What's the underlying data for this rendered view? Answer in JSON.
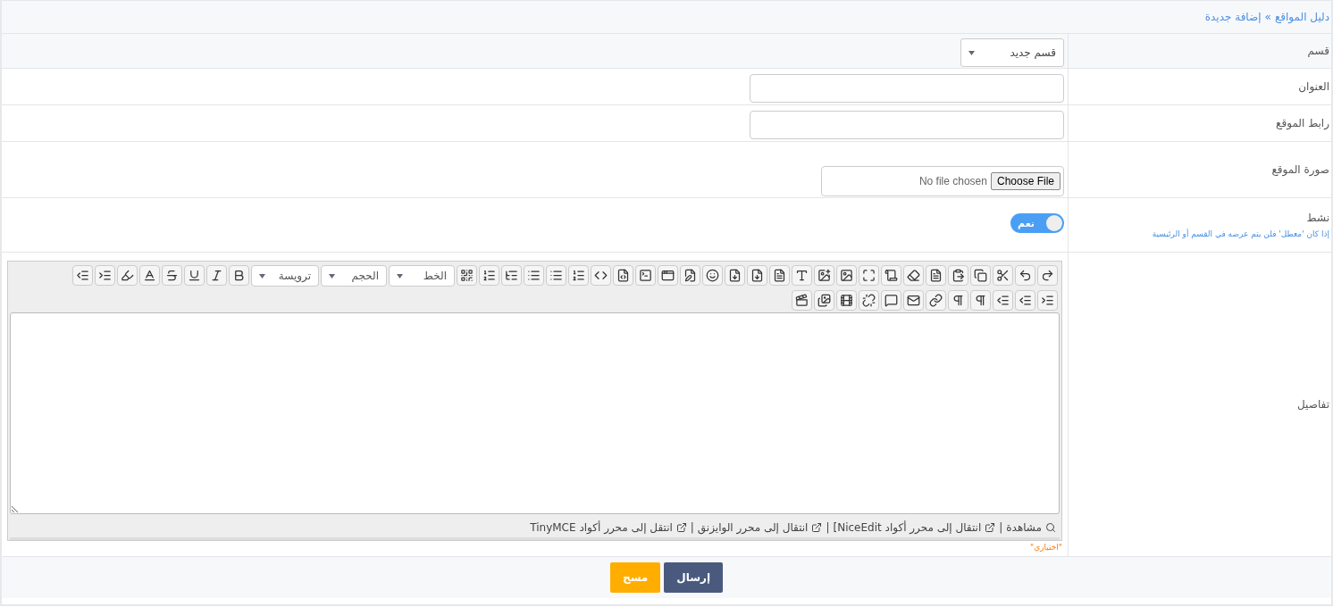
{
  "breadcrumb": {
    "items": [
      "دليل المواقع",
      "إضافة جديدة"
    ],
    "separator": "»"
  },
  "fields": [
    {
      "kind": "select",
      "label": "قسم",
      "value": "قسم جديد"
    },
    {
      "kind": "text",
      "label": "العنوان"
    },
    {
      "kind": "text",
      "label": "رابط الموقع"
    },
    {
      "kind": "file",
      "label": "صورة الموقع",
      "button": "Choose File",
      "status": "No file chosen"
    },
    {
      "kind": "toggle",
      "label": "نشط",
      "on": true,
      "state_label": "نعم",
      "hint": "إذا كان 'معطل' فلن يتم عرضه في القسم أو الرئيسية"
    },
    {
      "kind": "editor",
      "label": "تفاصيل",
      "dropdowns": [
        "الخط",
        "الحجم",
        "ترويسة"
      ],
      "links": [
        "مشاهدة",
        "انتقال إلى محرر أكواد NiceEdit]",
        "انتقال إلى محرر الوايزنق",
        "انتقل إلى محرر أكواد TinyMCE"
      ],
      "link_separator": "|",
      "note": "\"اختياري\""
    }
  ],
  "buttons": [
    {
      "kind": "primary",
      "label": "إرسال"
    },
    {
      "kind": "secondary",
      "label": "مسح"
    }
  ]
}
